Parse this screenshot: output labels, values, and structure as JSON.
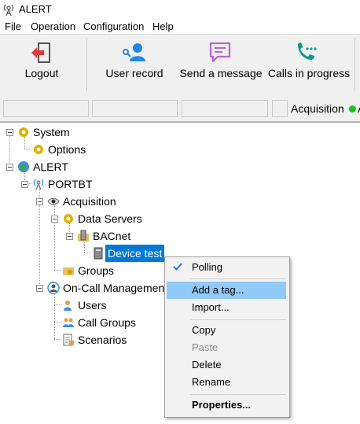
{
  "window": {
    "title": "ALERT"
  },
  "menu": [
    "File",
    "Operation",
    "Configuration",
    "Help"
  ],
  "toolbar": {
    "logout": "Logout",
    "user_record": "User record",
    "send_message": "Send a message",
    "calls_in_progress": "Calls in progress"
  },
  "status": {
    "acquisition_label": "Acquisition",
    "acquisition_state": "active",
    "overflow": "A"
  },
  "tree": {
    "system": "System",
    "options": "Options",
    "alert": "ALERT",
    "portbt": "PORTBT",
    "acquisition": "Acquisition",
    "data_servers": "Data Servers",
    "bacnet": "BACnet",
    "device_test": "Device test",
    "groups": "Groups",
    "on_call": "On-Call Managemen",
    "users": "Users",
    "call_groups": "Call Groups",
    "scenarios": "Scenarios"
  },
  "context_menu": {
    "polling": "Polling",
    "add_tag": "Add a tag...",
    "import": "Import...",
    "copy": "Copy",
    "paste": "Paste",
    "delete": "Delete",
    "rename": "Rename",
    "properties": "Properties..."
  },
  "colors": {
    "selection": "#0078d7",
    "menu_highlight": "#91c9f7",
    "acquisition_ok": "#19c219",
    "logout_red": "#e53935",
    "user_blue": "#1e88e5",
    "message_purple": "#b765d6",
    "phone_teal": "#0a9a8a"
  }
}
